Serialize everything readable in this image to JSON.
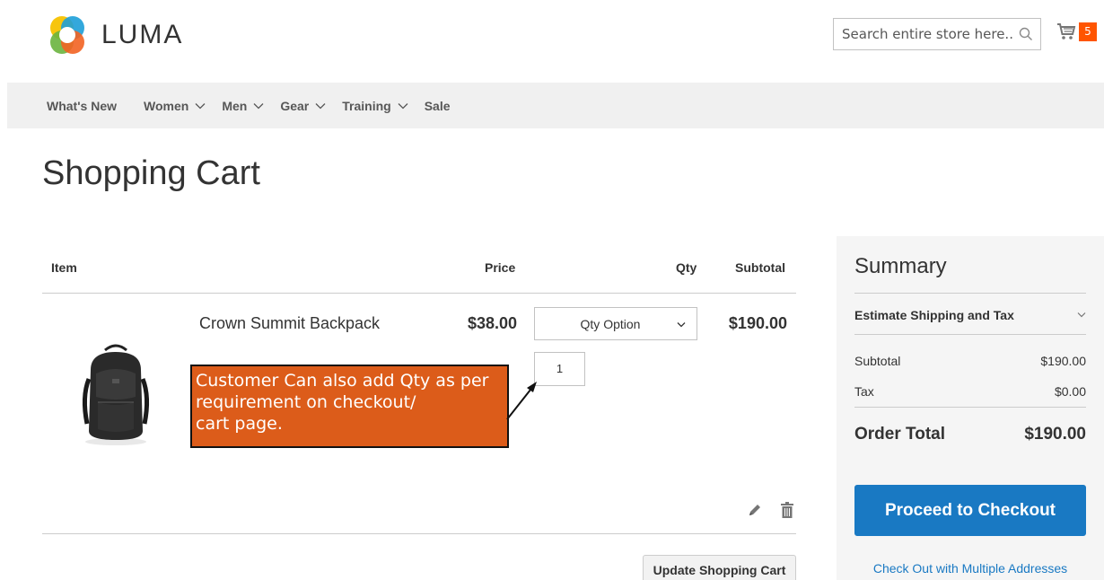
{
  "header": {
    "logo_text": "LUMA",
    "search": {
      "placeholder": "Search entire store here...",
      "value": ""
    },
    "cart_count": "5"
  },
  "nav": {
    "items": [
      {
        "label": "What's New",
        "has_dropdown": false
      },
      {
        "label": "Women",
        "has_dropdown": true
      },
      {
        "label": "Men",
        "has_dropdown": true
      },
      {
        "label": "Gear",
        "has_dropdown": true
      },
      {
        "label": "Training",
        "has_dropdown": true
      },
      {
        "label": "Sale",
        "has_dropdown": false
      }
    ]
  },
  "page": {
    "title": "Shopping Cart"
  },
  "cart": {
    "columns": {
      "item": "Item",
      "price": "Price",
      "qty": "Qty",
      "subtotal": "Subtotal"
    },
    "items": [
      {
        "name": "Crown Summit Backpack",
        "price": "$38.00",
        "qty_option_label": "Qty Option",
        "qty": "1",
        "subtotal": "$190.00"
      }
    ],
    "annotation": {
      "lines": [
        "Customer Can also add Qty as per",
        "requirement on checkout/",
        "cart page."
      ]
    },
    "update_label": "Update Shopping Cart"
  },
  "summary": {
    "title": "Summary",
    "estimate_label": "Estimate Shipping and Tax",
    "subtotal_label": "Subtotal",
    "subtotal_value": "$190.00",
    "tax_label": "Tax",
    "tax_value": "$0.00",
    "order_total_label": "Order Total",
    "order_total_value": "$190.00",
    "checkout_label": "Proceed to Checkout",
    "multi_address_label": "Check Out with Multiple Addresses"
  },
  "colors": {
    "accent_blue": "#1979c3",
    "badge_orange": "#ff5501",
    "callout_orange": "#dc5c1a",
    "nav_bg": "#f0f0f0",
    "summary_bg": "#f5f5f5"
  },
  "icons": [
    "luma-logo-icon",
    "search-icon",
    "cart-icon",
    "chevron-down-icon",
    "edit-icon",
    "trash-icon",
    "backpack-image"
  ]
}
